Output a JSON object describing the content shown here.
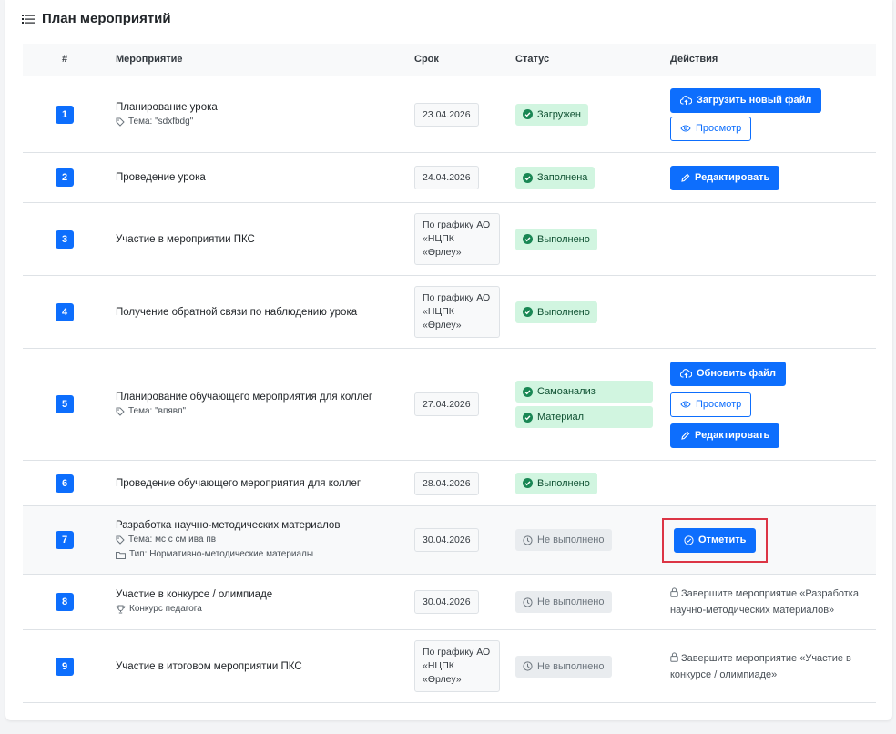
{
  "page": {
    "title": "План мероприятий"
  },
  "table": {
    "headers": {
      "num": "#",
      "event": "Мероприятие",
      "deadline": "Срок",
      "status": "Статус",
      "actions": "Действия"
    },
    "rows": [
      {
        "num": "1",
        "title": "Планирование урока",
        "topic": "Тема: \"sdxfbdg\"",
        "date": "23.04.2026",
        "status": [
          "Загружен"
        ],
        "btn_upload": "Загрузить новый файл",
        "btn_view": "Просмотр"
      },
      {
        "num": "2",
        "title": "Проведение урока",
        "date": "24.04.2026",
        "status": [
          "Заполнена"
        ],
        "btn_edit": "Редактировать"
      },
      {
        "num": "3",
        "title": "Участие в мероприятии ПКС",
        "date": "По графику АО «НЦПК «Өрлеу»",
        "status": [
          "Выполнено"
        ]
      },
      {
        "num": "4",
        "title": "Получение обратной связи по наблюдению урока",
        "date": "По графику АО «НЦПК «Өрлеу»",
        "status": [
          "Выполнено"
        ]
      },
      {
        "num": "5",
        "title": "Планирование обучающего мероприятия для коллег",
        "topic": "Тема: \"впявп\"",
        "date": "27.04.2026",
        "status": [
          "Самоанализ",
          "Материал"
        ],
        "btn_update": "Обновить файл",
        "btn_view": "Просмотр",
        "btn_edit": "Редактировать"
      },
      {
        "num": "6",
        "title": "Проведение обучающего мероприятия для коллег",
        "date": "28.04.2026",
        "status": [
          "Выполнено"
        ]
      },
      {
        "num": "7",
        "title": "Разработка научно-методических материалов",
        "topic": "Тема: мс с см ива пв",
        "type": "Тип: Нормативно-методические материалы",
        "date": "30.04.2026",
        "status": [
          "Не выполнено"
        ],
        "btn_mark": "Отметить"
      },
      {
        "num": "8",
        "title": "Участие в конкурсе / олимпиаде",
        "category": "Конкурс педагога",
        "date": "30.04.2026",
        "status": [
          "Не выполнено"
        ],
        "lock_note": "Завершите мероприятие «Разработка научно-методических материалов»"
      },
      {
        "num": "9",
        "title": "Участие в итоговом мероприятии ПКС",
        "date": "По графику АО «НЦПК «Өрлеу»",
        "status": [
          "Не выполнено"
        ],
        "lock_note": "Завершите мероприятие «Участие в конкурсе / олимпиаде»"
      }
    ]
  },
  "colors": {
    "primary": "#0d6efd",
    "success_bg": "#d1f5e0",
    "success_fg": "#0f5132",
    "muted_bg": "#e9ecef",
    "highlight": "#dc3545"
  }
}
